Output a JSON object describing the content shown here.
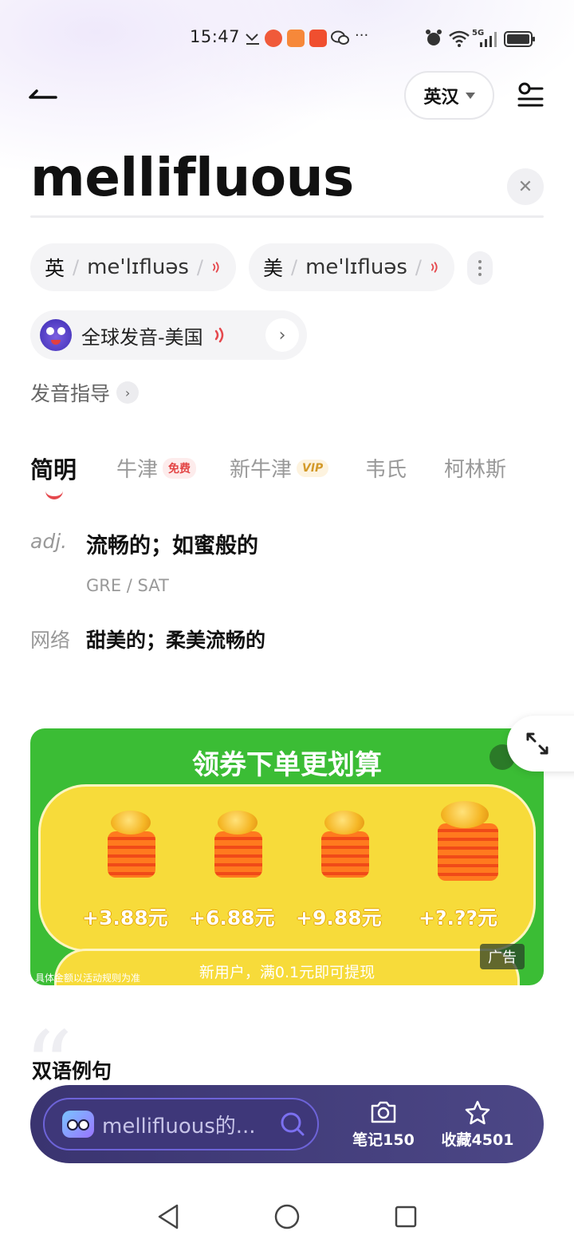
{
  "status_bar": {
    "time": "15:47",
    "network": "5G"
  },
  "header": {
    "language": "英汉"
  },
  "entry": {
    "word": "mellifluous",
    "pronunciations": [
      {
        "region": "英",
        "ipa": "me'lɪfluəs"
      },
      {
        "region": "美",
        "ipa": "me'lɪfluəs"
      }
    ],
    "global_pronunciation": "全球发音-美国",
    "guide": "发音指导"
  },
  "tabs": [
    {
      "label": "简明"
    },
    {
      "label": "牛津",
      "badge": "免费"
    },
    {
      "label": "新牛津",
      "badge": "VIP"
    },
    {
      "label": "韦氏"
    },
    {
      "label": "柯林斯"
    }
  ],
  "definitions": {
    "pos": "adj.",
    "meaning": "流畅的；如蜜般的",
    "tags": "GRE / SAT",
    "network_label": "网络",
    "network_meaning": "甜美的；柔美流畅的"
  },
  "ad": {
    "title": "领券下单更划算",
    "amounts": [
      "+3.88元",
      "+6.88元",
      "+9.88元",
      "+?.??元"
    ],
    "subtitle": "新用户，满0.1元即可提现",
    "fine_print": "具体金额以活动规则为准",
    "tag": "广告"
  },
  "examples": {
    "title": "双语例句"
  },
  "bottom_bar": {
    "search_text": "mellifluous的...",
    "notes_label": "笔记150",
    "favorites_label": "收藏4501"
  },
  "colors": {
    "accent": "#e5484d",
    "bar_bg": "#3a3470",
    "ad_green": "#3bbd35",
    "ad_yellow": "#f7db3a"
  }
}
